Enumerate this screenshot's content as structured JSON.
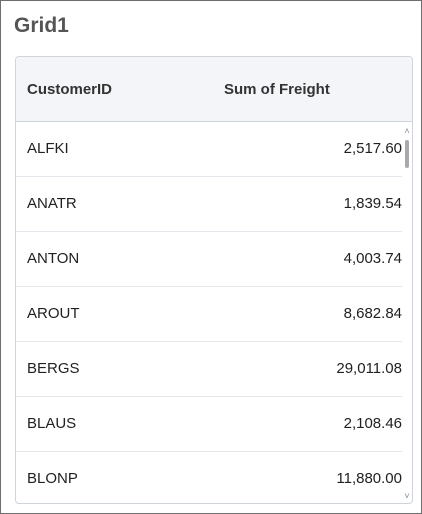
{
  "panel": {
    "title": "Grid1"
  },
  "grid": {
    "columns": [
      "CustomerID",
      "Sum of Freight"
    ],
    "rows": [
      {
        "customer_id": "ALFKI",
        "sum_of_freight": "2,517.60"
      },
      {
        "customer_id": "ANATR",
        "sum_of_freight": "1,839.54"
      },
      {
        "customer_id": "ANTON",
        "sum_of_freight": "4,003.74"
      },
      {
        "customer_id": "AROUT",
        "sum_of_freight": "8,682.84"
      },
      {
        "customer_id": "BERGS",
        "sum_of_freight": "29,011.08"
      },
      {
        "customer_id": "BLAUS",
        "sum_of_freight": "2,108.46"
      },
      {
        "customer_id": "BLONP",
        "sum_of_freight": "11,880.00"
      }
    ]
  },
  "icons": {
    "scroll_up": "chevron-up-icon",
    "scroll_down": "chevron-down-icon"
  }
}
